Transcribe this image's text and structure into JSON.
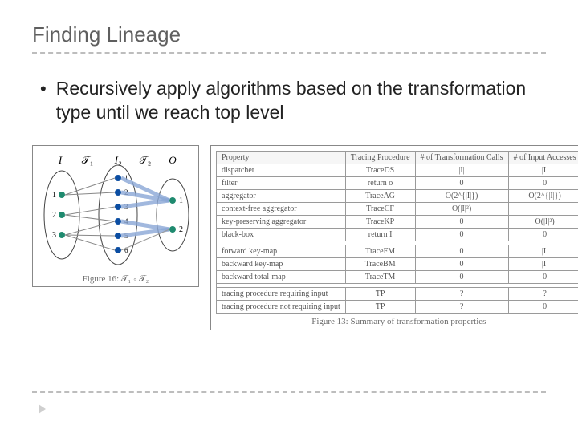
{
  "title": "Finding Lineage",
  "bullet": "Recursively apply algorithms based on the transformation type until we reach top level",
  "figure": {
    "label_I": "I",
    "label_T1": "𝒯₁",
    "label_I2": "I₂",
    "label_T2": "𝒯₂",
    "label_O": "O",
    "left_nodes": [
      "1",
      "2",
      "3"
    ],
    "mid_nodes": [
      "1",
      "2",
      "3",
      "4",
      "5",
      "6"
    ],
    "right_nodes": [
      "1",
      "2"
    ],
    "caption": "Figure 16: 𝒯₁ ∘ 𝒯₂"
  },
  "table": {
    "headers": [
      "Property",
      "Tracing Procedure",
      "# of Transformation Calls",
      "# of Input Accesses"
    ],
    "sections": [
      [
        {
          "prop": "dispatcher",
          "proc": "TraceDS",
          "calls": "|I|",
          "acc": "|I|"
        },
        {
          "prop": "filter",
          "proc": "return o",
          "calls": "0",
          "acc": "0"
        },
        {
          "prop": "aggregator",
          "proc": "TraceAG",
          "calls": "O(2^{|I|})",
          "acc": "O(2^{|I|})"
        },
        {
          "prop": "context-free aggregator",
          "proc": "TraceCF",
          "calls": "O(|I|²)",
          "acc": ""
        },
        {
          "prop": "key-preserving aggregator",
          "proc": "TraceKP",
          "calls": "0",
          "acc": "O(|I|²)"
        },
        {
          "prop": "black-box",
          "proc": "return I",
          "calls": "0",
          "acc": "0"
        }
      ],
      [
        {
          "prop": "forward key-map",
          "proc": "TraceFM",
          "calls": "0",
          "acc": "|I|"
        },
        {
          "prop": "backward key-map",
          "proc": "TraceBM",
          "calls": "0",
          "acc": "|I|"
        },
        {
          "prop": "backward total-map",
          "proc": "TraceTM",
          "calls": "0",
          "acc": "0"
        }
      ],
      [
        {
          "prop": "tracing procedure requiring input",
          "proc": "TP",
          "calls": "?",
          "acc": "?"
        },
        {
          "prop": "tracing procedure not requiring input",
          "proc": "TP",
          "calls": "?",
          "acc": "0"
        }
      ]
    ],
    "caption": "Figure 13: Summary of transformation properties"
  }
}
